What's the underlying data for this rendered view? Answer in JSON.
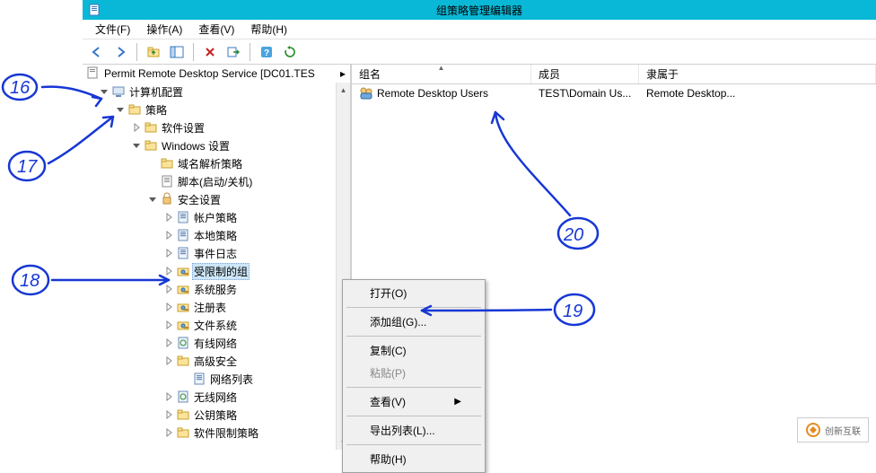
{
  "window": {
    "title": "组策略管理编辑器"
  },
  "menu": {
    "file": "文件(F)",
    "action": "操作(A)",
    "view": "查看(V)",
    "help": "帮助(H)"
  },
  "header_text": "Permit Remote Desktop Service [DC01.TES",
  "header_expand": "▸",
  "tree": [
    {
      "level": 1,
      "twisty": "open",
      "icon": "computer",
      "label": "计算机配置"
    },
    {
      "level": 2,
      "twisty": "open",
      "icon": "folder",
      "label": "策略"
    },
    {
      "level": 3,
      "twisty": "closed",
      "icon": "folder",
      "label": "软件设置"
    },
    {
      "level": 3,
      "twisty": "open",
      "icon": "folder",
      "label": "Windows 设置"
    },
    {
      "level": 4,
      "twisty": "none",
      "icon": "folder",
      "label": "域名解析策略"
    },
    {
      "level": 4,
      "twisty": "none",
      "icon": "script",
      "label": "脚本(启动/关机)"
    },
    {
      "level": 4,
      "twisty": "open",
      "icon": "security",
      "label": "安全设置"
    },
    {
      "level": 5,
      "twisty": "closed",
      "icon": "policy",
      "label": "帐户策略"
    },
    {
      "level": 5,
      "twisty": "closed",
      "icon": "policy",
      "label": "本地策略"
    },
    {
      "level": 5,
      "twisty": "closed",
      "icon": "policy",
      "label": "事件日志"
    },
    {
      "level": 5,
      "twisty": "closed",
      "icon": "group",
      "label": "受限制的组",
      "selected": true
    },
    {
      "level": 5,
      "twisty": "closed",
      "icon": "group",
      "label": "系统服务"
    },
    {
      "level": 5,
      "twisty": "closed",
      "icon": "group",
      "label": "注册表"
    },
    {
      "level": 5,
      "twisty": "closed",
      "icon": "group",
      "label": "文件系统"
    },
    {
      "level": 5,
      "twisty": "closed",
      "icon": "policy-net",
      "label": "有线网络"
    },
    {
      "level": 5,
      "twisty": "closed",
      "icon": "folder",
      "label": "高级安全"
    },
    {
      "level": 6,
      "twisty": "none",
      "icon": "policy",
      "label": "网络列表"
    },
    {
      "level": 5,
      "twisty": "closed",
      "icon": "policy-net",
      "label": "无线网络"
    },
    {
      "level": 5,
      "twisty": "closed",
      "icon": "folder",
      "label": "公钥策略"
    },
    {
      "level": 5,
      "twisty": "closed",
      "icon": "folder",
      "label": "软件限制策略"
    }
  ],
  "list": {
    "columns": {
      "name": "组名",
      "member": "成员",
      "belong": "隶属于"
    },
    "rows": [
      {
        "icon": "users",
        "name": "Remote Desktop Users",
        "member": "TEST\\Domain Us...",
        "belong": "Remote Desktop..."
      }
    ]
  },
  "context_menu": {
    "open": "打开(O)",
    "add_group": "添加组(G)...",
    "copy": "复制(C)",
    "paste": "粘贴(P)",
    "view": "查看(V)",
    "export": "导出列表(L)...",
    "help": "帮助(H)"
  },
  "annotations": {
    "a16": "16",
    "a17": "17",
    "a18": "18",
    "a19": "19",
    "a20": "20"
  },
  "logo": "创新互联"
}
